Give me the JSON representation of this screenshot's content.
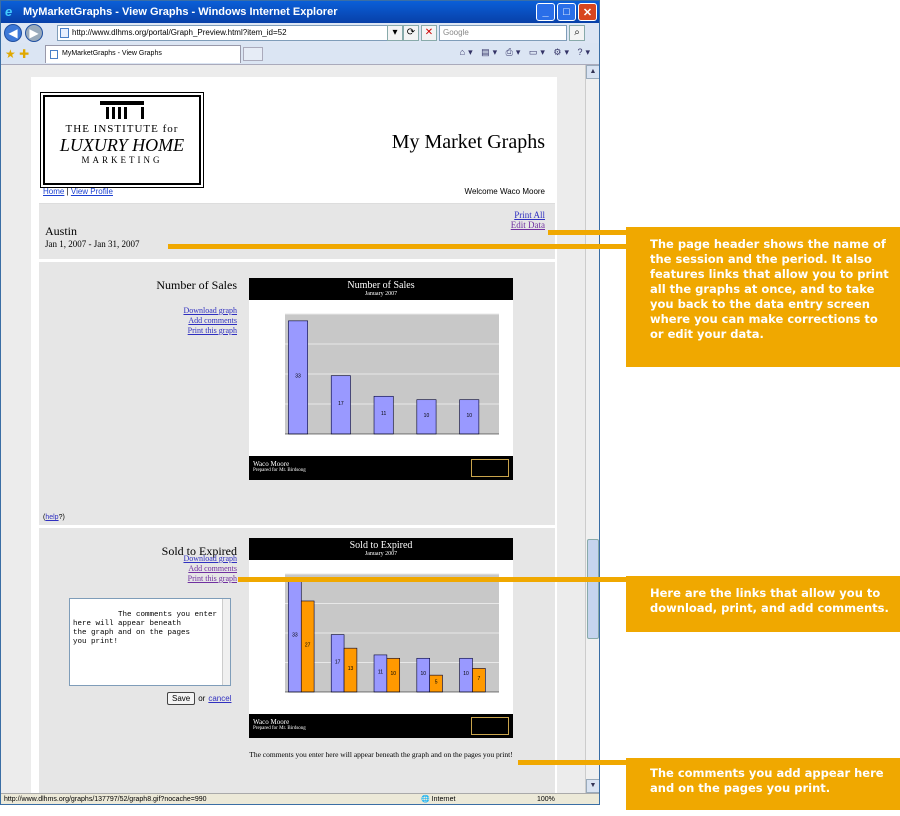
{
  "browser": {
    "title": "MyMarketGraphs - View Graphs - Windows Internet Explorer",
    "url": "http://www.dlhms.org/portal/Graph_Preview.html?item_id=52",
    "search_placeholder": "Google",
    "tab_label": "MyMarketGraphs - View Graphs",
    "status_url": "http://www.dlhms.org/graphs/137797/52/graph8.gif?nocache=990",
    "status_zone": "Internet",
    "status_zoom": "100%"
  },
  "page": {
    "logo": {
      "line1": "THE INSTITUTE for",
      "line2": "LUXURY HOME",
      "line3": "MARKETING"
    },
    "site_title": "My Market Graphs",
    "nav": {
      "home": "Home",
      "separator": "|",
      "profile": "View Profile"
    },
    "welcome": "Welcome Waco Moore",
    "session": {
      "name": "Austin",
      "period": "Jan 1, 2007 - Jan 31, 2007"
    },
    "header_links": {
      "print_all": "Print All",
      "edit_data": "Edit Data"
    },
    "help": {
      "open": "(",
      "link": "help",
      "close": "?)"
    }
  },
  "graphs": [
    {
      "title": "Number of Sales",
      "links": {
        "download": "Download graph",
        "comments": "Add comments",
        "print": "Print this graph"
      },
      "chart_title": "Number of Sales",
      "chart_subtitle": "January 2007",
      "footer_name": "Waco Moore",
      "footer_prepared": "Prepared for Mr. Birdsong"
    },
    {
      "title": "Sold to Expired",
      "links": {
        "download": "Download graph",
        "comments": "Add comments",
        "print": "Print this graph"
      },
      "chart_title": "Sold to Expired",
      "chart_subtitle": "January 2007",
      "footer_name": "Waco Moore",
      "footer_prepared": "Prepared for Mr. Birdsong",
      "comment_text": "The comments you enter\nhere will appear beneath\nthe graph and on the pages\nyou print!",
      "save_label": "Save",
      "or_label": "or",
      "cancel_label": "cancel",
      "comment_display": "The comments you enter here will appear beneath the graph and on the pages you print!"
    }
  ],
  "chart_data": [
    {
      "type": "bar",
      "title": "Number of Sales",
      "subtitle": "January 2007",
      "categories": [
        "",
        "",
        "",
        "",
        ""
      ],
      "values": [
        33,
        17,
        11,
        10,
        10
      ],
      "ylim": [
        0,
        35
      ],
      "colors": [
        "#9999ff"
      ]
    },
    {
      "type": "bar",
      "title": "Sold to Expired",
      "subtitle": "January 2007",
      "categories": [
        "",
        "",
        "",
        "",
        ""
      ],
      "series": [
        {
          "values": [
            33,
            17,
            11,
            10,
            10
          ],
          "color": "#9999ff"
        },
        {
          "values": [
            27,
            13,
            10,
            5,
            7
          ],
          "color": "#ff9900"
        }
      ],
      "ylim": [
        0,
        35
      ]
    }
  ],
  "callouts": {
    "header": "The page header shows the name of the session and the period. It also features links that allow you to print all the graphs at once, and to take you back to the data entry screen where you can make corrections to or edit your data.",
    "links": "Here are the links that allow you to download, print, and add comments.",
    "comments": "The comments you add appear here and on the pages you print."
  },
  "colors": {
    "callout": "#f0a800",
    "link": "#3030c0",
    "visited": "#7030a0"
  }
}
